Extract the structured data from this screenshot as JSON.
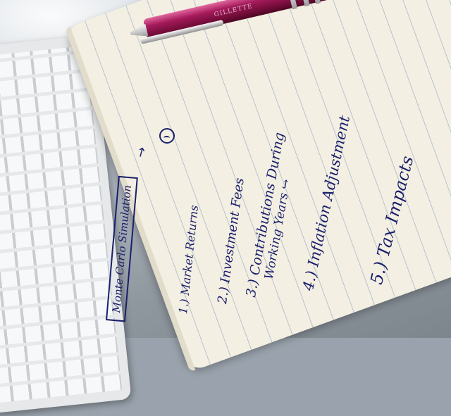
{
  "notebook": {
    "title": "Monte Carlo Simulation",
    "items": [
      {
        "number": "1.)",
        "text": "Market Returns"
      },
      {
        "number": "2.)",
        "text": "Investment Fees"
      },
      {
        "number": "3.)",
        "text": "Contributions During"
      },
      {
        "continuation": "Working Years"
      },
      {
        "number": "4.)",
        "text": "Inflation Adjustment"
      },
      {
        "number": "5.)",
        "text": "Tax Impacts"
      }
    ],
    "ink_color": "#1a1f6b",
    "paper_color": "#f3efe2"
  },
  "pen": {
    "imprint": "GILLETTE",
    "body_color": "#a51a5b"
  },
  "icons": [
    "arrow-up-icon",
    "sad-face-icon",
    "arrow-right-icon"
  ]
}
